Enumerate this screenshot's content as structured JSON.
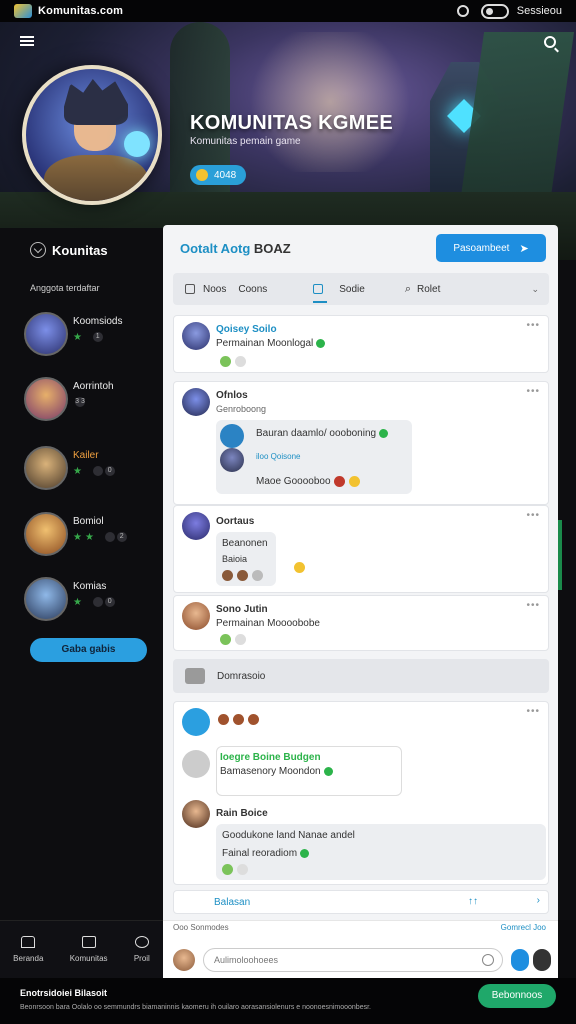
{
  "app": {
    "name": "Komunitas.com",
    "session_label": "Sessieou"
  },
  "hero": {
    "title": "KOMUNITAS KGMEE",
    "subtitle": "Komunitas pemain game",
    "badge": "4048"
  },
  "sidebar": {
    "heading": "Kounitas",
    "subheading": "Anggota terdaftar",
    "members": [
      {
        "name": "Koomsiods",
        "level": "1"
      },
      {
        "name": "Aorrintoh",
        "level": "3 3"
      },
      {
        "name": "Kailer",
        "level": "0"
      },
      {
        "name": "Bomiol",
        "level": "2"
      },
      {
        "name": "Komias",
        "level": "0"
      }
    ],
    "cta": "Gaba gabis"
  },
  "panel": {
    "title_accent": "Ootalt Aotg",
    "title_rest": "BOAZ",
    "action_button": "Pasoambeet",
    "tabs": [
      {
        "label": "Noos"
      },
      {
        "label": "Coons"
      },
      {
        "label": "Sodie"
      },
      {
        "label": "Rolet"
      }
    ],
    "posts": [
      {
        "name": "Qoisey Soilo",
        "text": "Permainan Moonlogal"
      },
      {
        "name": "Ofnlos",
        "subtitle": "Genroboong",
        "bubble_1": "Bauran daamlo/ oooboning",
        "bubble_2": "iloo Qoisone",
        "bubble_3": "Maoe Gooooboo"
      },
      {
        "name": "Oortaus",
        "bubble_1": "Beanonen",
        "bubble_2": "Baioia"
      },
      {
        "name": "Sono Jutin",
        "text": "Permainan Moooobobe"
      }
    ],
    "section_label": "Domrasoio",
    "thread": {
      "quote_name": "Ioegre Boine Budgen",
      "quote_text": "Bamasenory Moondon",
      "reply_name": "Rain Boice",
      "reply_bubble_1": "Goodukone land Nanae andel",
      "reply_bubble_2": "Fainal reoradiom"
    },
    "reply_bar_label": "Balasan",
    "reply_bar_icon": "↑↑"
  },
  "bottom_nav": [
    {
      "label": "Beranda"
    },
    {
      "label": "Komunitas"
    },
    {
      "label": "Proil"
    }
  ],
  "composer": {
    "top_left": "Ooo Sonmodes",
    "top_right": "Gomrecl Joo",
    "placeholder": "Aulimoloohoees"
  },
  "footer": {
    "line1": "Enotrsidoiei Bilasoit",
    "line2": "Beonrsoon bara Oolalo oo semmundrs biamaninnis kaomeru ih ouilaro aorasansiolenurs e noonoesnimooonbesr.",
    "button": "Bebonnoos"
  },
  "colors": {
    "accent": "#1e8ee0",
    "green": "#2cb34a",
    "footer_btn": "#1fa86a"
  }
}
